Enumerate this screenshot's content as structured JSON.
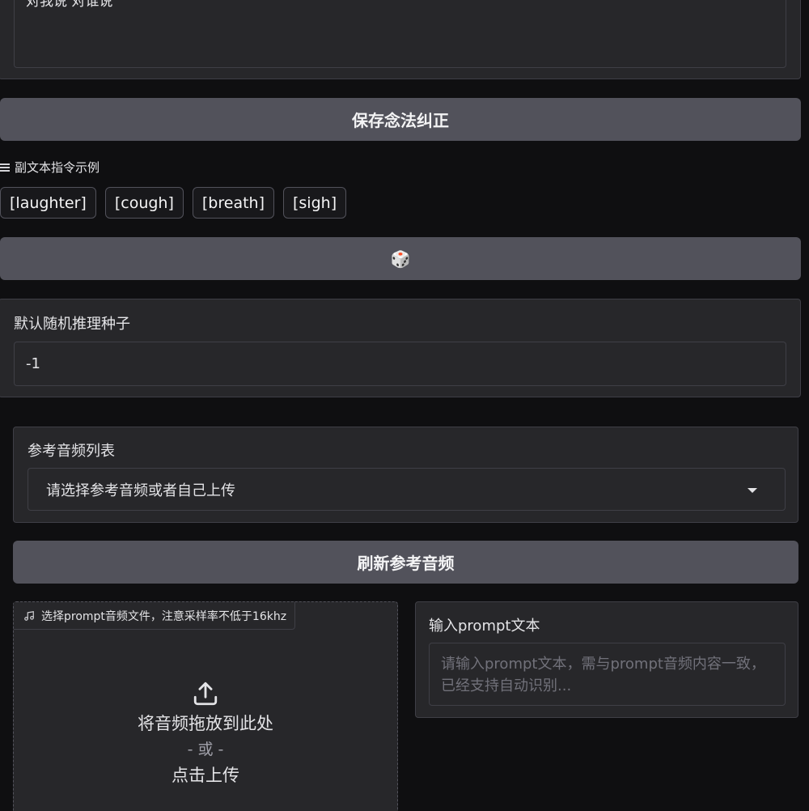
{
  "top_textarea": {
    "value": "对我说 对谁说"
  },
  "save_correction_button": {
    "label": "保存念法纠正"
  },
  "examples": {
    "label": "副文本指令示例",
    "chips": [
      "[laughter]",
      "[cough]",
      "[breath]",
      "[sigh]"
    ]
  },
  "dice_button": {
    "icon": "dice-icon",
    "glyph": "🎲"
  },
  "seed": {
    "label": "默认随机推理种子",
    "value": "-1"
  },
  "ref_audio": {
    "label": "参考音频列表",
    "selected": "请选择参考音频或者自己上传"
  },
  "refresh_button": {
    "label": "刷新参考音频"
  },
  "upload": {
    "tag_label": "选择prompt音频文件，注意采样率不低于16khz",
    "drop_text": "将音频拖放到此处",
    "or_text": "- 或 -",
    "click_text": "点击上传"
  },
  "prompt_text": {
    "label": "输入prompt文本",
    "placeholder": "请输入prompt文本，需与prompt音频内容一致，已经支持自动识别..."
  }
}
